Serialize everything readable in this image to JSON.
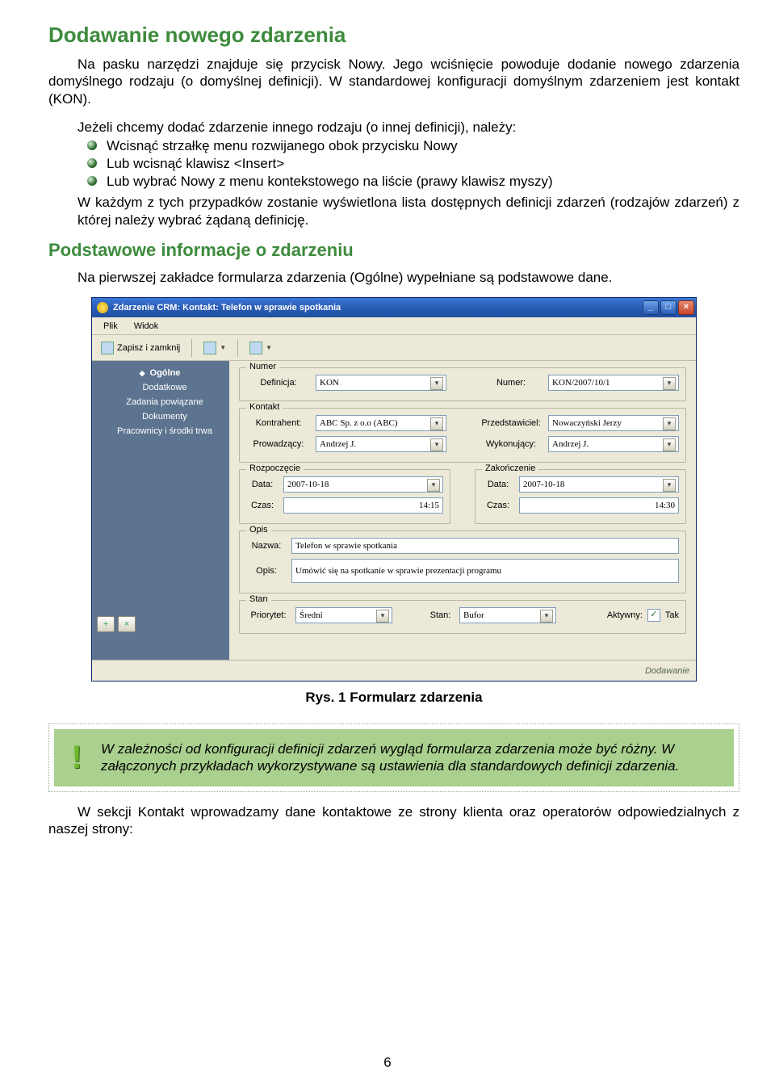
{
  "headings": {
    "h1": "Dodawanie nowego zdarzenia",
    "h2": "Podstawowe informacje o zdarzeniu"
  },
  "paragraphs": {
    "p1": "Na pasku narzędzi znajduje się przycisk Nowy. Jego wciśnięcie powoduje dodanie nowego zdarzenia domyślnego rodzaju (o domyślnej definicji). W standardowej konfiguracji domyślnym zdarzeniem jest kontakt (KON).",
    "p2_lead": "Jeżeli chcemy dodać zdarzenie innego rodzaju (o innej definicji), należy:",
    "bullets": [
      "Wcisnąć strzałkę menu rozwijanego obok przycisku Nowy",
      "Lub wcisnąć klawisz <Insert>",
      "Lub wybrać Nowy z menu kontekstowego na liście (prawy klawisz myszy)"
    ],
    "p2_tail": "W każdym z tych przypadków zostanie wyświetlona lista dostępnych definicji zdarzeń (rodzajów zdarzeń) z której należy wybrać żądaną definicję.",
    "p3": "Na pierwszej zakładce formularza zdarzenia (Ogólne) wypełniane są podstawowe dane.",
    "caption": "Rys. 1 Formularz zdarzenia",
    "callout": "W zależności od konfiguracji definicji zdarzeń wygląd formularza zdarzenia może być różny. W załączonych przykładach wykorzystywane są ustawienia dla standardowych definicji zdarzenia.",
    "p4": "W sekcji Kontakt wprowadzamy dane kontaktowe ze strony klienta oraz operatorów odpowiedzialnych z naszej strony:"
  },
  "window": {
    "title": "Zdarzenie CRM: Kontakt: Telefon w sprawie spotkania",
    "menu": {
      "plik": "Plik",
      "widok": "Widok"
    },
    "toolbar": {
      "zapisz": "Zapisz i zamknij"
    },
    "nav": {
      "items": [
        "Ogólne",
        "Dodatkowe",
        "Zadania powiązane",
        "Dokumenty",
        "Pracownicy i środki trwa"
      ]
    },
    "groups": {
      "numer": {
        "title": "Numer",
        "definicja_lbl": "Definicja:",
        "definicja_val": "KON",
        "numer_lbl": "Numer:",
        "numer_val": "KON/2007/10/1"
      },
      "kontakt": {
        "title": "Kontakt",
        "kontrahent_lbl": "Kontrahent:",
        "kontrahent_val": "ABC Sp. z o.o (ABC)",
        "przedstawiciel_lbl": "Przedstawiciel:",
        "przedstawiciel_val": "Nowaczyński Jerzy",
        "prowadzacy_lbl": "Prowadzący:",
        "prowadzacy_val": "Andrzej J.",
        "wykonujacy_lbl": "Wykonujący:",
        "wykonujacy_val": "Andrzej J."
      },
      "rozpoczecie": {
        "title": "Rozpoczęcie",
        "data_lbl": "Data:",
        "data_val": "2007-10-18",
        "czas_lbl": "Czas:",
        "czas_val": "14:15"
      },
      "zakonczenie": {
        "title": "Zakończenie",
        "data_lbl": "Data:",
        "data_val": "2007-10-18",
        "czas_lbl": "Czas:",
        "czas_val": "14:30"
      },
      "opis": {
        "title": "Opis",
        "nazwa_lbl": "Nazwa:",
        "nazwa_val": "Telefon w sprawie spotkania",
        "opis_lbl": "Opis:",
        "opis_val": "Umówić się na spotkanie w sprawie prezentacji programu"
      },
      "stan": {
        "title": "Stan",
        "priorytet_lbl": "Priorytet:",
        "priorytet_val": "Średni",
        "stan_lbl": "Stan:",
        "stan_val": "Bufor",
        "aktywny_lbl": "Aktywny:",
        "aktywny_chk": "✓",
        "aktywny_tak": "Tak"
      }
    },
    "footer": "Dodawanie"
  },
  "page_number": "6"
}
